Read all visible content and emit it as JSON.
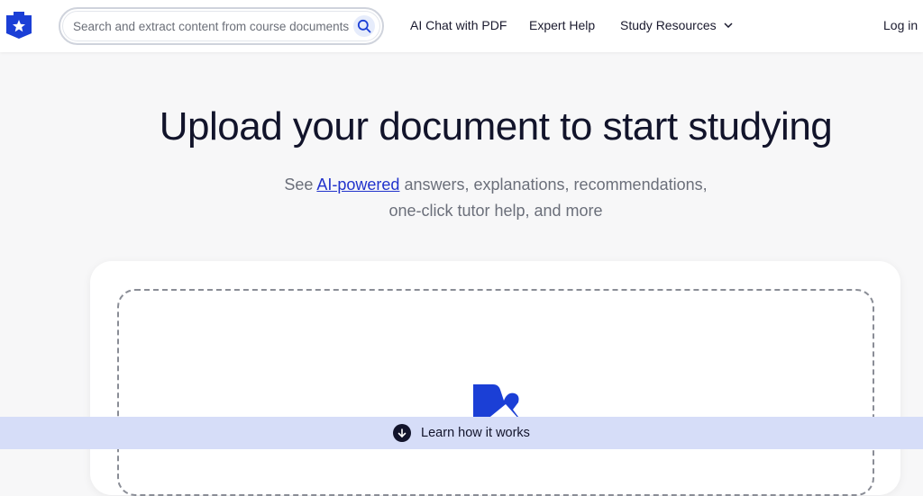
{
  "header": {
    "search": {
      "placeholder": "Search and extract content from course documents, study resources, and expert Q&As"
    },
    "nav": {
      "ai_chat": "AI Chat with PDF",
      "expert_help": "Expert Help",
      "study_resources": "Study Resources",
      "login": "Log in"
    }
  },
  "hero": {
    "title": "Upload your document to start studying",
    "subtitle_prefix": "See ",
    "subtitle_link": "AI-powered",
    "subtitle_line1_rest": " answers, explanations, recommendations,",
    "subtitle_line2": "one-click tutor help, and more"
  },
  "bottom_bar": {
    "label": "Learn how it works"
  },
  "colors": {
    "brand_blue": "#1b3fd6",
    "link_blue": "#2233cc",
    "bottom_bar": "#d6ddf8"
  }
}
